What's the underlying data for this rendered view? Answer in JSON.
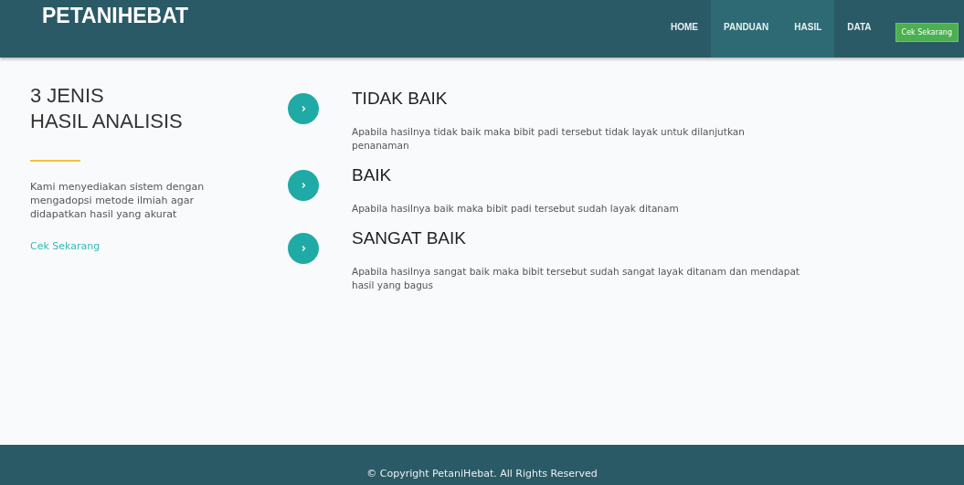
{
  "navbar": {
    "brand": "PETANIHEBAT",
    "items": [
      {
        "label": "HOME",
        "selected": false
      },
      {
        "label": "PANDUAN",
        "selected": true
      },
      {
        "label": "HASIL",
        "selected": true
      },
      {
        "label": "DATA",
        "selected": false
      }
    ],
    "cta": "Cek Sekarang"
  },
  "intro": {
    "title_lines": [
      "3 JENIS",
      "HASIL ANALISIS"
    ],
    "text": "Kami menyediakan sistem dengan mengadopsi metode ilmiah agar didapatkan hasil yang akurat",
    "link": "Cek Sekarang"
  },
  "results": [
    {
      "title": "TIDAK BAIK",
      "text": "Apabila hasilnya tidak baik maka bibit padi tersebut tidak layak untuk dilanjutkan penanaman"
    },
    {
      "title": "BAIK",
      "text": "Apabila hasilnya baik maka bibit padi tersebut sudah layak ditanam"
    },
    {
      "title": "SANGAT BAIK",
      "text": "Apabila hasilnya sangat baik maka bibit tersebut sudah sangat layak ditanam dan mendapat hasil yang bagus"
    }
  ],
  "footer": "© Copyright PetaniHebat. All Rights Reserved"
}
